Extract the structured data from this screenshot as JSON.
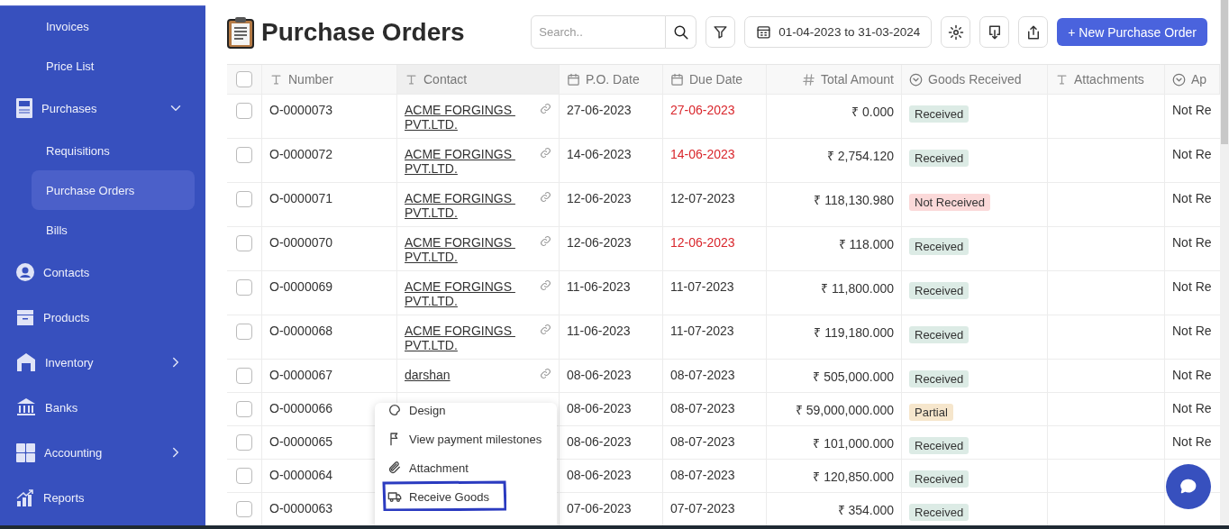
{
  "sidebar": {
    "items": [
      {
        "kind": "sub",
        "label": "Invoices",
        "selected": false
      },
      {
        "kind": "sub",
        "label": "Price List",
        "selected": false
      },
      {
        "kind": "po",
        "label": "Purchases",
        "expanded": true
      },
      {
        "kind": "sub",
        "label": "Requisitions",
        "selected": false
      },
      {
        "kind": "sub",
        "label": "Purchase Orders",
        "selected": true
      },
      {
        "kind": "sub",
        "label": "Bills",
        "selected": false
      },
      {
        "kind": "user",
        "label": "Contacts"
      },
      {
        "kind": "box",
        "label": "Products"
      },
      {
        "kind": "warehouse",
        "label": "Inventory",
        "expanded": false
      },
      {
        "kind": "bank",
        "label": "Banks"
      },
      {
        "kind": "calc",
        "label": "Accounting",
        "expanded": false
      },
      {
        "kind": "chart",
        "label": "Reports"
      }
    ]
  },
  "header": {
    "title": "Purchase Orders",
    "search": {
      "placeholder": "Search.."
    },
    "date_range": "01-04-2023 to 31-03-2024",
    "new_button": "+ New Purchase Order"
  },
  "table": {
    "all_checked": false,
    "columns": [
      {
        "kind": "text",
        "label": "Number"
      },
      {
        "kind": "text",
        "label": "Contact"
      },
      {
        "kind": "calendar",
        "label": "P.O. Date"
      },
      {
        "kind": "calendar",
        "label": "Due Date"
      },
      {
        "kind": "hash",
        "label": "Total Amount"
      },
      {
        "kind": "status",
        "label": "Goods Received"
      },
      {
        "kind": "text",
        "label": "Attachments"
      },
      {
        "kind": "status",
        "label": "Ap"
      }
    ],
    "rows": [
      {
        "checked": false,
        "number": "O-0000073",
        "contact": [
          "ACME FORGINGS ",
          "PVT.LTD."
        ],
        "po_date": "27-06-2023",
        "due_date": "27-06-2023",
        "overdue": true,
        "total": "₹ 0.000",
        "goods": {
          "kind": "received",
          "label": "Received"
        },
        "column_8": "Not Re"
      },
      {
        "checked": false,
        "number": "O-0000072",
        "contact": [
          "ACME FORGINGS ",
          "PVT.LTD."
        ],
        "po_date": "14-06-2023",
        "due_date": "14-06-2023",
        "overdue": true,
        "total": "₹ 2,754.120",
        "goods": {
          "kind": "received",
          "label": "Received"
        },
        "column_8": "Not Re"
      },
      {
        "checked": false,
        "number": "O-0000071",
        "contact": [
          "ACME FORGINGS ",
          "PVT.LTD."
        ],
        "po_date": "12-06-2023",
        "due_date": "12-07-2023",
        "overdue": false,
        "total": "₹ 118,130.980",
        "goods": {
          "kind": "not_received",
          "label": "Not Received"
        },
        "column_8": "Not Re"
      },
      {
        "checked": false,
        "number": "O-0000070",
        "contact": [
          "ACME FORGINGS ",
          "PVT.LTD."
        ],
        "po_date": "12-06-2023",
        "due_date": "12-06-2023",
        "overdue": true,
        "total": "₹ 118.000",
        "goods": {
          "kind": "received",
          "label": "Received"
        },
        "column_8": "Not Re"
      },
      {
        "checked": false,
        "number": "O-0000069",
        "contact": [
          "ACME FORGINGS ",
          "PVT.LTD."
        ],
        "po_date": "11-06-2023",
        "due_date": "11-07-2023",
        "overdue": false,
        "total": "₹ 11,800.000",
        "goods": {
          "kind": "received",
          "label": "Received"
        },
        "column_8": "Not Re"
      },
      {
        "checked": false,
        "number": "O-0000068",
        "contact": [
          "ACME FORGINGS ",
          "PVT.LTD."
        ],
        "po_date": "11-06-2023",
        "due_date": "11-07-2023",
        "overdue": false,
        "total": "₹ 119,180.000",
        "goods": {
          "kind": "received",
          "label": "Received"
        },
        "column_8": "Not Re"
      },
      {
        "checked": false,
        "number": "O-0000067",
        "contact": [
          "darshan"
        ],
        "po_date": "08-06-2023",
        "due_date": "08-07-2023",
        "overdue": false,
        "total": "₹ 505,000.000",
        "goods": {
          "kind": "received",
          "label": "Received"
        },
        "column_8": "Not Re"
      },
      {
        "checked": false,
        "number": "O-0000066",
        "po_date": "08-06-2023",
        "due_date": "08-07-2023",
        "overdue": false,
        "total": "₹ 59,000,000.000",
        "goods": {
          "kind": "partial",
          "label": "Partial"
        },
        "column_8": "Not Re"
      },
      {
        "checked": false,
        "number": "O-0000065",
        "po_date": "08-06-2023",
        "due_date": "08-07-2023",
        "overdue": false,
        "total": "₹ 101,000.000",
        "goods": {
          "kind": "received",
          "label": "Received"
        },
        "column_8": "Not Re"
      },
      {
        "checked": false,
        "number": "O-0000064",
        "po_date": "08-06-2023",
        "due_date": "08-07-2023",
        "overdue": false,
        "total": "₹ 120,850.000",
        "goods": {
          "kind": "received",
          "label": "Received"
        }
      },
      {
        "checked": false,
        "number": "O-0000063",
        "po_date": "07-06-2023",
        "due_date": "07-07-2023",
        "overdue": false,
        "total": "₹ 354.000",
        "goods": {
          "kind": "received",
          "label": "Received"
        }
      }
    ]
  },
  "context_menu": {
    "items": [
      {
        "kind": "design",
        "label": "Design"
      },
      {
        "kind": "flag",
        "label": "View payment milestones"
      },
      {
        "kind": "clip",
        "label": "Attachment"
      },
      {
        "kind": "truck",
        "label": "Receive Goods",
        "annotated": true
      }
    ]
  }
}
